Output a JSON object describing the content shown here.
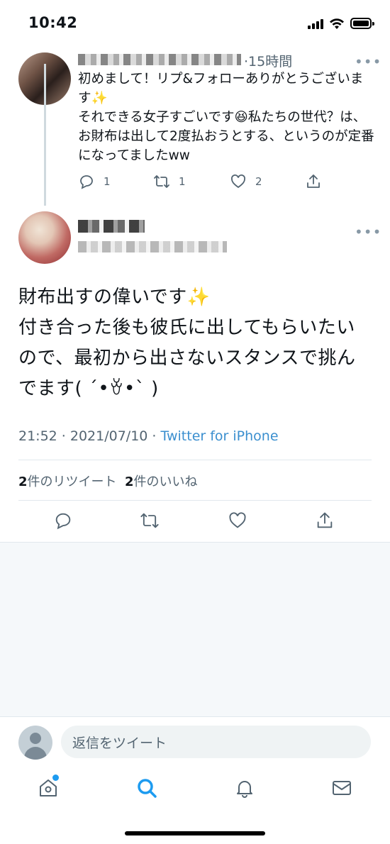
{
  "status_bar": {
    "time": "10:42"
  },
  "reply_tweet": {
    "time_label": "·15時間",
    "text_line1": "初めまして！リプ&フォローありがとうございます✨",
    "text_line2": "それできる女子すごいです😆私たちの世代？は、お財布は出して2度払おうとする、というのが定番になってましたww",
    "reply_count": "1",
    "retweet_count": "1",
    "like_count": "2"
  },
  "main_tweet": {
    "text_line1": "財布出すの偉いです✨",
    "text_line2": "付き合った後も彼氏に出してもらいたいので、最初から出さないスタンスで挑んでます( ˊ•ꈊ•ˋ )",
    "meta_time": "21:52 · 2021/07/10 · ",
    "meta_source": "Twitter for iPhone",
    "retweet_num": "2",
    "retweet_label": "件のリツイート",
    "like_num": "2",
    "like_label": "件のいいね"
  },
  "reply_bar": {
    "placeholder": "返信をツイート"
  },
  "icons": {
    "status": [
      "signal-icon",
      "wifi-icon",
      "battery-icon"
    ],
    "tabs": [
      "home-icon",
      "search-icon",
      "notifications-icon",
      "messages-icon"
    ],
    "accent": "#1d9bf0"
  }
}
